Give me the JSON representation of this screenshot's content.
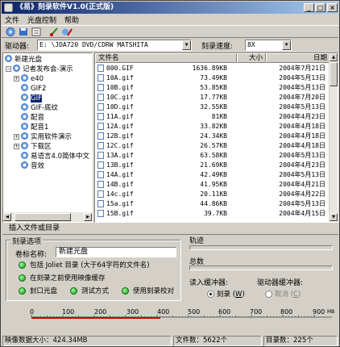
{
  "window": {
    "title": "《易》刻录软件V1.0(正式版)"
  },
  "menu": [
    "文件",
    "光盘控制",
    "帮助"
  ],
  "drive": {
    "label": "驱动器:",
    "value": "E: \\JDA720 DVD/CDRW MATSHITA",
    "speed_label": "刻录速度:",
    "speed_value": "8X"
  },
  "tree": {
    "items": [
      {
        "label": "新建光盘"
      },
      {
        "label": "记者发布会-演示"
      },
      {
        "label": "e40"
      },
      {
        "label": "GIF2"
      },
      {
        "label": "GIF"
      },
      {
        "label": "GIF-底纹"
      },
      {
        "label": "配音"
      },
      {
        "label": "配音1"
      },
      {
        "label": "实用软件演示"
      },
      {
        "label": "下载区"
      },
      {
        "label": "易语言4.0简体中文"
      },
      {
        "label": "音效"
      }
    ]
  },
  "list": {
    "headers": {
      "name": "文件名",
      "size": "大小",
      "date": "日期"
    },
    "rows": [
      {
        "name": "000.GIF",
        "size": "1636.89KB",
        "date": "2004年7月21日"
      },
      {
        "name": "10A.gif",
        "size": "73.49KB",
        "date": "2004年5月13日"
      },
      {
        "name": "10B.gif",
        "size": "53.85KB",
        "date": "2004年5月13日"
      },
      {
        "name": "10C.gif",
        "size": "17.77KB",
        "date": "2004年7月20日"
      },
      {
        "name": "10D.gif",
        "size": "32.55KB",
        "date": "2004年5月13日"
      },
      {
        "name": "11A.gif",
        "size": "81KB",
        "date": "2004年4月23日"
      },
      {
        "name": "12A.gif",
        "size": "33.82KB",
        "date": "2004年4月18日"
      },
      {
        "name": "12B.gif",
        "size": "24.34KB",
        "date": "2004年4月18日"
      },
      {
        "name": "12C.gif",
        "size": "26.57KB",
        "date": "2004年4月18日"
      },
      {
        "name": "13A.gif",
        "size": "63.58KB",
        "date": "2004年5月13日"
      },
      {
        "name": "13B.gif",
        "size": "21.69KB",
        "date": "2004年4月23日"
      },
      {
        "name": "14A.gif",
        "size": "42.49KB",
        "date": "2004年5月13日"
      },
      {
        "name": "14B.gif",
        "size": "41.95KB",
        "date": "2004年4月21日"
      },
      {
        "name": "14c.gif",
        "size": "20.11KB",
        "date": "2004年4月22日"
      },
      {
        "name": "15a.gif",
        "size": "44.86KB",
        "date": "2004年5月13日"
      },
      {
        "name": "15B.gif",
        "size": "39.7KB",
        "date": "2004年4月15日"
      }
    ]
  },
  "insert_label": "插入文件或目录",
  "options": {
    "group_title": "刻录选项",
    "volume_label": "卷标名称:",
    "volume_value": "新建光盘",
    "joliet": "包括 Joliet 目录 (大于64字符的文件名)",
    "cache": "在刻录之前使用映像缓存",
    "close_disc": "封口光盘",
    "test_mode": "测试方式",
    "verify": "使用刻录校对"
  },
  "progress": {
    "track_label": "轨迹",
    "total_label": "总数",
    "input_buffer": "读入缓冲器:",
    "drive_buffer": "驱动器缓冲器:",
    "burn_label": "刻录 (",
    "burn_key": "W",
    "cancel_label": "取消 (",
    "cancel_key": "C"
  },
  "ruler": {
    "ticks": [
      "0",
      "100",
      "200",
      "300",
      "400",
      "500",
      "600",
      "700",
      "800",
      "900"
    ],
    "unit": "MB"
  },
  "status": {
    "image_size": "映像数据大小：424.34MB",
    "file_count": "文件数：5622个",
    "dir_count": "目录数：225个"
  },
  "colors": {
    "titlebar": "#0a246a",
    "selection": "#0a246a",
    "ruler_red": "#d00000"
  }
}
